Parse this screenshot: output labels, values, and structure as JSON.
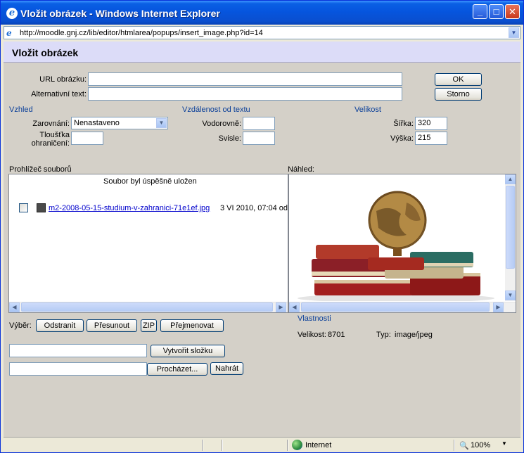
{
  "window": {
    "title": "Vložit obrázek - Windows Internet Explorer"
  },
  "address": {
    "url": "http://moodle.gnj.cz/lib/editor/htmlarea/popups/insert_image.php?id=14"
  },
  "page": {
    "heading": "Vložit obrázek"
  },
  "form": {
    "url_label": "URL obrázku:",
    "url_value": "",
    "alt_label": "Alternativní text:",
    "alt_value": "",
    "ok_label": "OK",
    "cancel_label": "Storno"
  },
  "appearance": {
    "heading": "Vzhled",
    "align_label": "Zarovnání:",
    "align_value": "Nenastaveno",
    "border_label": "Tloušťka ohraničení:",
    "border_value": ""
  },
  "spacing": {
    "heading": "Vzdálenost od textu",
    "horizontal_label": "Vodorovně:",
    "horizontal_value": "",
    "vertical_label": "Svisle:",
    "vertical_value": ""
  },
  "size": {
    "heading": "Velikost",
    "width_label": "Šířka:",
    "width_value": "320",
    "height_label": "Výška:",
    "height_value": "215"
  },
  "browser": {
    "label": "Prohlížeč souborů",
    "status": "Soubor byl úspěšně uložen",
    "files": [
      {
        "name": "m2-2008-05-15-studium-v-zahranici-71e1ef.jpg",
        "date": "3 VI 2010, 07:04 od"
      }
    ]
  },
  "preview": {
    "label": "Náhled:"
  },
  "selection": {
    "label": "Výběr:",
    "delete_label": "Odstranit",
    "move_label": "Přesunout",
    "zip_label": "ZIP",
    "rename_label": "Přejmenovat"
  },
  "properties": {
    "heading": "Vlastnosti",
    "size_label": "Velikost:",
    "size_value": "8701",
    "type_label": "Typ:",
    "type_value": "image/jpeg"
  },
  "folder": {
    "create_label": "Vytvořit složku",
    "name_value": ""
  },
  "upload": {
    "browse_label": "Procházet...",
    "upload_label": "Nahrát",
    "file_value": ""
  },
  "status": {
    "zone": "Internet",
    "zoom": "100%"
  },
  "icons": [
    "ie-icon",
    "minimize-icon",
    "maximize-icon",
    "close-icon",
    "dropdown-arrow-icon",
    "image-file-icon",
    "globe-icon",
    "zoom-icon"
  ]
}
